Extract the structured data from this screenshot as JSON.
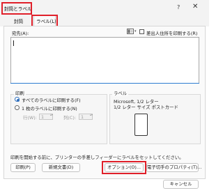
{
  "window": {
    "title": "封筒とラベル",
    "help_glyph": "?",
    "close_glyph": "✕"
  },
  "tabs": [
    {
      "label": "封筒"
    },
    {
      "label": "ラベル(L)"
    }
  ],
  "address": {
    "label": "宛先(A):",
    "value": ""
  },
  "return_address": {
    "checkbox_label": "差出人住所を印刷する(R)",
    "checked": false,
    "dropdown_glyph": "▾"
  },
  "print": {
    "group_label": "印刷",
    "option_all": "すべてのラベルに印刷する(F)",
    "option_one": "1 枚のラベルに印刷する(N)",
    "row_label": "行(W):",
    "row_value": "1",
    "col_label": "列(C):",
    "col_value": "1",
    "spin_glyph": "▴▾"
  },
  "label": {
    "group_label": "ラベル",
    "line1": "Microsoft, 1/2 レター",
    "line2": "1/2 レター サイズ ポストカード"
  },
  "info_text": "印刷を開始する前に、プリンターの手差しフィーダーにラベルをセットしてください。",
  "buttons": {
    "print": "印刷(P)",
    "new_document": "新規文書(D)",
    "options": "オプション(O)...",
    "epostage": "電子切手のプロパティ(T)...",
    "cancel": "キャンセル"
  },
  "colors": {
    "highlight": "#e0202a",
    "accent": "#2f6fbd"
  },
  "icons": {
    "address_book": "address-book-icon"
  }
}
